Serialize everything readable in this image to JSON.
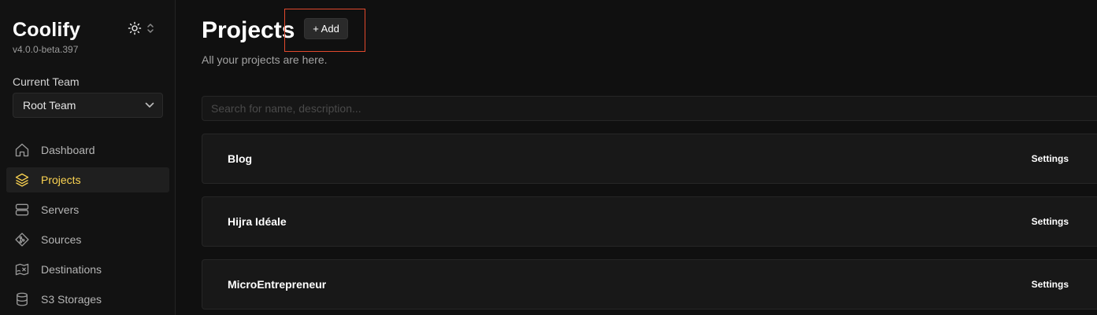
{
  "sidebar": {
    "brand": "Coolify",
    "version": "v4.0.0-beta.397",
    "team_label": "Current Team",
    "team_value": "Root Team",
    "nav": [
      {
        "label": "Dashboard",
        "icon": "home-icon"
      },
      {
        "label": "Projects",
        "icon": "layers-icon",
        "active": true
      },
      {
        "label": "Servers",
        "icon": "server-icon"
      },
      {
        "label": "Sources",
        "icon": "git-icon"
      },
      {
        "label": "Destinations",
        "icon": "destination-icon"
      },
      {
        "label": "S3 Storages",
        "icon": "database-icon"
      }
    ]
  },
  "main": {
    "title": "Projects",
    "add_label": "+ Add",
    "subtitle": "All your projects are here.",
    "search_placeholder": "Search for name, description...",
    "projects": [
      {
        "name": "Blog",
        "settings_label": "Settings"
      },
      {
        "name": "Hijra Idéale",
        "settings_label": "Settings"
      },
      {
        "name": "MicroEntrepreneur",
        "settings_label": "Settings"
      }
    ]
  },
  "colors": {
    "background": "#101010",
    "accent": "#fcd452",
    "highlight": "#e2492d"
  }
}
